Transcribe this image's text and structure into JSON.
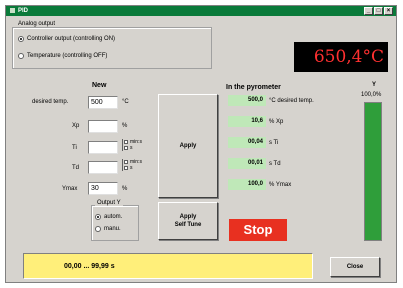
{
  "window": {
    "title": "PID",
    "min": "_",
    "max": "□",
    "close": "×"
  },
  "analog_output": {
    "title": "Analog output",
    "options": [
      "Controller output (controlling ON)",
      "Temperature (controlling OFF)"
    ],
    "selected_index": 0
  },
  "display": {
    "value": "650,4°C"
  },
  "new": {
    "header": "New",
    "desired_temp": {
      "label": "desired temp.",
      "value": "500",
      "unit": "°C"
    },
    "xp": {
      "label": "Xp",
      "value": "",
      "unit": "%"
    },
    "ti": {
      "label": "Ti",
      "value": "",
      "opt1": "min:s",
      "opt2": "s"
    },
    "td": {
      "label": "Td",
      "value": "",
      "opt1": "min:s",
      "opt2": "s"
    },
    "ymax": {
      "label": "Ymax",
      "value": "30",
      "unit": "%"
    },
    "output_y": {
      "title": "Output Y",
      "options": [
        "autom.",
        "manu."
      ],
      "selected_index": 0
    }
  },
  "buttons": {
    "apply": "Apply",
    "apply_self_tune_1": "Apply",
    "apply_self_tune_2": "Self Tune",
    "stop": "Stop",
    "close": "Close"
  },
  "pyrometer": {
    "header": "In the pyrometer",
    "rows": [
      {
        "value": "500,0",
        "unit": "°C desired temp."
      },
      {
        "value": "10,6",
        "unit": "% Xp"
      },
      {
        "value": "00,04",
        "unit": "s Ti"
      },
      {
        "value": "00,01",
        "unit": "s Td"
      },
      {
        "value": "100,0",
        "unit": "% Ymax"
      }
    ]
  },
  "y_bar": {
    "label": "Y",
    "value_text": "100,0%",
    "level_percent": 100,
    "color": "#2f9e3a"
  },
  "status": {
    "text": "00,00 ... 99,99 s",
    "color": "#ffef7a"
  }
}
